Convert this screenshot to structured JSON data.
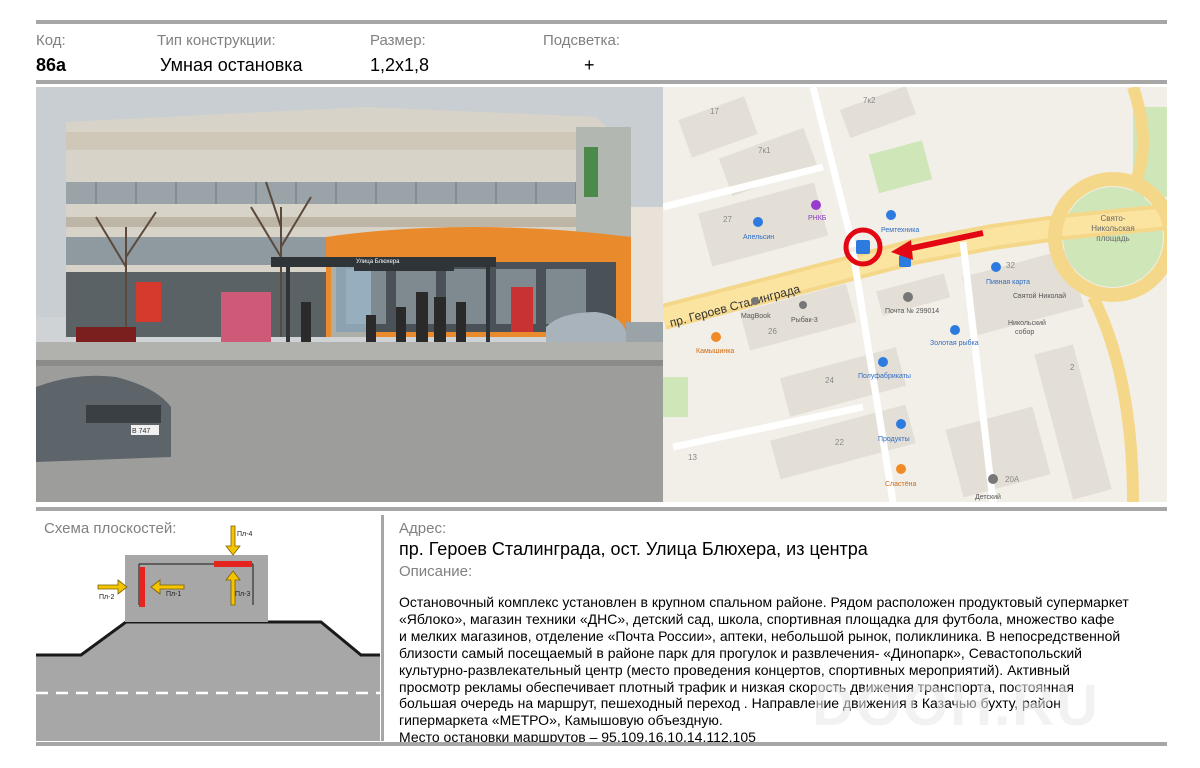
{
  "header": {
    "code_label": "Код:",
    "code_value": "86а",
    "type_label": "Тип конструкции:",
    "type_value": "Умная остановка",
    "size_label": "Размер:",
    "size_value": "1,2х1,8",
    "light_label": "Подсветка:",
    "light_value": "+"
  },
  "photo": {
    "stop_sign": "Улица Блюхера",
    "car_plate": "В 747"
  },
  "map": {
    "street": "пр. Героев Сталинграда",
    "square": [
      "Свято-",
      "Никольская",
      "площадь"
    ],
    "places": [
      "Апельсин",
      "РНКБ",
      "Ремтехника",
      "Пивная карта",
      "Святой Николай",
      "Никольский",
      "собор",
      "MagBook",
      "Рыбак-3",
      "Почта № 299014",
      "Золотая рыбка",
      "Камышинка",
      "Полуфабрикаты",
      "Продукты",
      "Сластёна",
      "Детский"
    ],
    "numbers": [
      "17",
      "7к2",
      "7к1",
      "27",
      "32",
      "26",
      "24",
      "22",
      "13",
      "2",
      "20А"
    ]
  },
  "schema": {
    "title": "Схема плоскостей:",
    "planes": [
      "Пл-1",
      "Пл-2",
      "Пл-3",
      "Пл-4"
    ]
  },
  "address": {
    "label": "Адрес:",
    "value": "пр. Героев Сталинграда, ост. Улица Блюхера, из центра"
  },
  "description": {
    "label": "Описание:",
    "lines": [
      "Остановочный комплекс установлен в крупном спальном районе. Рядом расположен продуктовый супермаркет",
      "«Яблоко», магазин техники «ДНС», детский сад, школа, спортивная  площадка для футбола, множество кафе",
      "и мелких магазинов, отделение «Почта России», аптеки, небольшой рынок, поликлиника. В непосредственной",
      "близости самый посещаемый в районе парк для прогулок и развлечения- «Динопарк», Севастопольский",
      "культурно-развлекательный центр (место проведения концертов, спортивных мероприятий). Активный",
      "просмотр рекламы обеспечивает плотный трафик и низкая скорость движения транспорта, постоянная",
      "большая очередь на маршрут, пешеходный переход . Направление движения в Казачью бухту, район",
      "гипермаркета «МЕТРО», Камышовую объездную.",
      "Место остановки маршрутов – 95,109,16,10,14,112,105"
    ]
  },
  "watermark": "DOOH.RU",
  "colors": {
    "rule": "#a6a6a6",
    "label": "#808080",
    "marker": "#e30613",
    "plane": "#e52420",
    "arrow": "#f5c400"
  }
}
